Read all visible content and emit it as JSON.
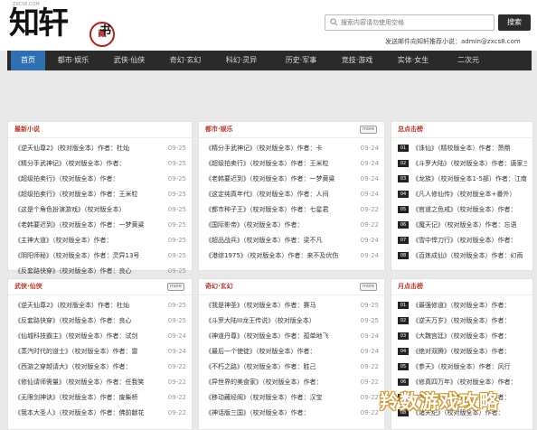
{
  "header": {
    "logo_small": "ZXCS8.COM",
    "logo_main": "知轩",
    "logo_seal": "藏",
    "logo_seal_text": "书",
    "search_placeholder": "搜索内容请勿使用空格",
    "search_button": "搜索",
    "feedback": "发送邮件向知轩推荐小说：admin@zxcs8.com"
  },
  "nav": [
    "首页",
    "都市·娱乐",
    "武侠·仙侠",
    "奇幻·玄幻",
    "科幻·灵异",
    "历史·军事",
    "竞技·游戏",
    "实体·女生",
    "二次元"
  ],
  "more_label": "more",
  "panels": {
    "latest": {
      "title": "最新小说",
      "rows": [
        {
          "text": "《逆天仙尊2》（校对版全本）作者：杜灿",
          "date": "09-25"
        },
        {
          "text": "《精分手武神记》（校对版全本）作者：",
          "date": "09-25"
        },
        {
          "text": "《超级拍卖行》（校对版全本）作者：",
          "date": "09-25"
        },
        {
          "text": "《超级拍卖行》（校对版全本）作者：王米粒",
          "date": "09-25"
        },
        {
          "text": "《这是个角色扮演游戏》（校对版全本）",
          "date": "09-25"
        },
        {
          "text": "《老韩要迟到》（校对版全本）作者：一梦黄粱",
          "date": "09-25"
        },
        {
          "text": "《主神大道》（校对版全本）作者：",
          "date": "09-25"
        },
        {
          "text": "《阴阳师秘》（校对版全本）作者：灵异13号",
          "date": "09-25"
        },
        {
          "text": "《反套路快穿》（校对版全本）作者：良心",
          "date": "09-25"
        }
      ]
    },
    "urban": {
      "title": "都市·娱乐",
      "rows": [
        {
          "text": "《精分手武神记》（校对版全本）作者：卡",
          "date": "09-24"
        },
        {
          "text": "《超级拍卖行》（校对版全本）作者：王米粒",
          "date": "09-24"
        },
        {
          "text": "《老韩要迟到》（校对版全本）作者：一梦黄粱",
          "date": "09-24"
        },
        {
          "text": "《这定纯真年代》（校对版全本）作者：人间",
          "date": "09-24"
        },
        {
          "text": "《都市种子王》（校对版全本）作者：七星君",
          "date": "09-22"
        },
        {
          "text": "《国际影帝》（校对版全本）作者：",
          "date": "09-22"
        },
        {
          "text": "《超品战兵》（校对版全本）作者：梁不凡",
          "date": "09-24"
        },
        {
          "text": "《港综1975》（校对版全本）作者：来不及优伤",
          "date": "09-24"
        }
      ]
    },
    "hot": {
      "title": "总点击榜",
      "rows": [
        {
          "num": "01",
          "text": "《诛仙》（精校版全本）作者：萧鼎"
        },
        {
          "num": "02",
          "text": "《斗罗大陆》（校对版全本）作者：唐家三少"
        },
        {
          "num": "03",
          "text": "《龙族》（校对版全本1-5部）作者：江南"
        },
        {
          "num": "04",
          "text": "《凡人修仙传》（校对版全本+番外）"
        },
        {
          "num": "05",
          "text": "《官道之色戒》（校对版全本）作者："
        },
        {
          "num": "06",
          "text": "《魔天记》（校对版全本）作者：忘语"
        },
        {
          "num": "07",
          "text": "《雪中悍刀行》（校对版全本）作者："
        },
        {
          "num": "08",
          "text": "《百炼成仙》（校对版全本）作者：幻雨"
        }
      ]
    },
    "wuxia": {
      "title": "武侠·仙侠",
      "rows": [
        {
          "text": "《逆天仙尊2》（校对版全本）作者：杜灿",
          "date": "09-25"
        },
        {
          "text": "《反套路快穿》（校对版全本）作者：良心",
          "date": "09-25"
        },
        {
          "text": "《仙城科技霸主》（校对版全本）作者：试剑",
          "date": "09-24"
        },
        {
          "text": "《蒸汽时代的道士》（校对版全本）作者：雷",
          "date": "09-24"
        },
        {
          "text": "《西游之穿越请大》（校对版全本）作者：",
          "date": "09-22"
        },
        {
          "text": "《修仙请师需量》（校对版全本）作者：任我笑",
          "date": "09-22"
        },
        {
          "text": "《无限剑神诀》（校对版全本）作者：废柴桥",
          "date": "09-22"
        },
        {
          "text": "《我本大圣人》（校对版全本）作者：佛前献花",
          "date": "09-22"
        }
      ]
    },
    "fantasy": {
      "title": "奇幻·玄幻",
      "rows": [
        {
          "text": "《我是神圣》（校对版全本）作者：赛马",
          "date": "09-25"
        },
        {
          "text": "《斗罗大陆III龙王传说》（校对版全本）",
          "date": "09-25"
        },
        {
          "text": "《神道丹尊》（校对版全本）作者：孤单地飞",
          "date": "09-24"
        },
        {
          "text": "《最后一个使徒》（校对版全本）作者：",
          "date": "09-24"
        },
        {
          "text": "《不朽之路》（校对版全本）作者：胜己",
          "date": "09-22"
        },
        {
          "text": "《异世界的美食家》（校对版全本）作者：",
          "date": "09-22"
        },
        {
          "text": "《移动藏经阁》（校对版全本）作者：汉宝",
          "date": "09-22"
        },
        {
          "text": "《神话版三国》（校对版全本）作者：",
          "date": "09-22"
        }
      ]
    },
    "monthly": {
      "title": "月点击榜",
      "rows": [
        {
          "num": "01",
          "text": "《最强修道》（校对版全本）作者："
        },
        {
          "num": "02",
          "text": "《逆天万岁》（校对版全本）作者："
        },
        {
          "num": "03",
          "text": "《大魏宫廷》（校对版全本）作者："
        },
        {
          "num": "04",
          "text": "《绝对双腾》（校对版全本）作者："
        },
        {
          "num": "05",
          "text": "《参天》（校对版全本）作者：风行"
        },
        {
          "num": "06",
          "text": "《修真四万年》（校对版全本）作者："
        },
        {
          "num": "07",
          "text": "《神道丹尊》（校对版全本）作者："
        },
        {
          "num": "08",
          "text": "《诸天纪》（校对版全本）作者："
        }
      ]
    }
  },
  "watermark": "羚数游戏攻略"
}
